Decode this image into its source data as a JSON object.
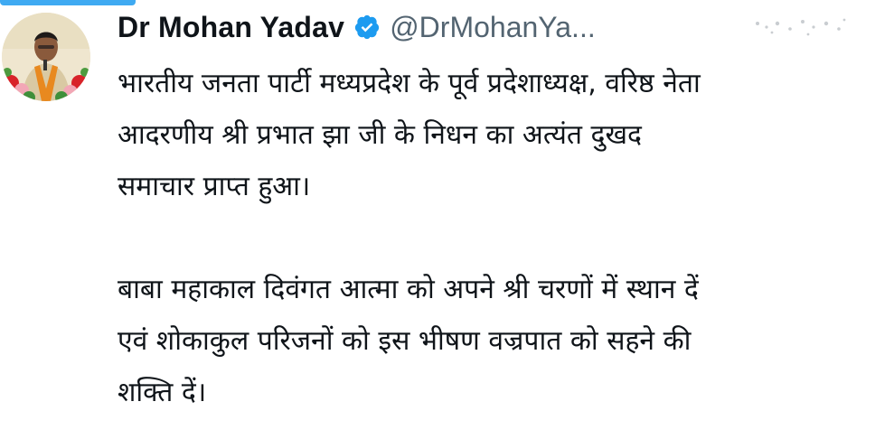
{
  "tweet": {
    "author_name": "Dr Mohan Yadav",
    "author_handle": "@DrMohanYa...",
    "verified": true,
    "verified_color": "#1d9bf0",
    "paragraph1_lines": [
      "भारतीय जनता पार्टी मध्यप्रदेश के पूर्व प्रदेशाध्यक्ष, वरिष्ठ नेता",
      "आदरणीय श्री प्रभात झा जी के निधन का अत्यंत दुखद",
      "समाचार प्राप्त हुआ।"
    ],
    "paragraph2_lines": [
      "बाबा महाकाल दिवंगत आत्मा को अपने श्री चरणों में स्थान दें",
      "एवं शोकाकुल परिजनों को इस भीषण वज्रपात को सहने की",
      "शक्ति दें।"
    ]
  },
  "icons": {
    "avatar": "profile-photo",
    "verified": "verified-badge-icon",
    "more": "more-options-icon"
  }
}
